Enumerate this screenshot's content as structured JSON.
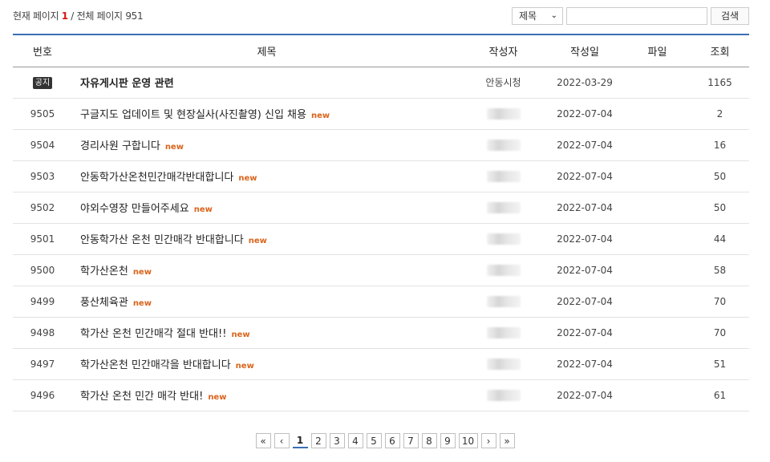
{
  "page_info": {
    "prefix": "현재 페이지",
    "current": "1",
    "sep": " / ",
    "total_label": "전체 페이지",
    "total": "951"
  },
  "search": {
    "select_value": "제목",
    "placeholder": "",
    "button_label": "검색"
  },
  "table": {
    "headers": [
      "번호",
      "제목",
      "작성자",
      "작성일",
      "파일",
      "조회"
    ],
    "notice": {
      "badge": "공지",
      "title": "자유게시판 운영 관련",
      "author": "안동시청",
      "date": "2022-03-29",
      "file": "",
      "views": "1165"
    },
    "rows": [
      {
        "no": "9505",
        "title": "구글지도 업데이트 및 현장실사(사진촬영) 신입 채용",
        "new": "new",
        "date": "2022-07-04",
        "views": "2"
      },
      {
        "no": "9504",
        "title": "경리사원 구합니다",
        "new": "new",
        "date": "2022-07-04",
        "views": "16"
      },
      {
        "no": "9503",
        "title": "안동학가산온천민간매각반대합니다",
        "new": "new",
        "date": "2022-07-04",
        "views": "50"
      },
      {
        "no": "9502",
        "title": "야외수영장 만들어주세요",
        "new": "new",
        "date": "2022-07-04",
        "views": "50"
      },
      {
        "no": "9501",
        "title": "안동학가산 온천 민간매각 반대합니다",
        "new": "new",
        "date": "2022-07-04",
        "views": "44"
      },
      {
        "no": "9500",
        "title": "학가산온천",
        "new": "new",
        "date": "2022-07-04",
        "views": "58"
      },
      {
        "no": "9499",
        "title": "풍산체육관",
        "new": "new",
        "date": "2022-07-04",
        "views": "70"
      },
      {
        "no": "9498",
        "title": "학가산 온천 민간매각 절대 반대!!",
        "new": "new",
        "date": "2022-07-04",
        "views": "70"
      },
      {
        "no": "9497",
        "title": "학가산온천 민간매각을 반대합니다",
        "new": "new",
        "date": "2022-07-04",
        "views": "51"
      },
      {
        "no": "9496",
        "title": "학가산 온천 민간 매각 반대!",
        "new": "new",
        "date": "2022-07-04",
        "views": "61"
      }
    ]
  },
  "pagination": {
    "first": "«",
    "prev": "‹",
    "pages": [
      "1",
      "2",
      "3",
      "4",
      "5",
      "6",
      "7",
      "8",
      "9",
      "10"
    ],
    "current": "1",
    "next": "›",
    "last": "»"
  }
}
